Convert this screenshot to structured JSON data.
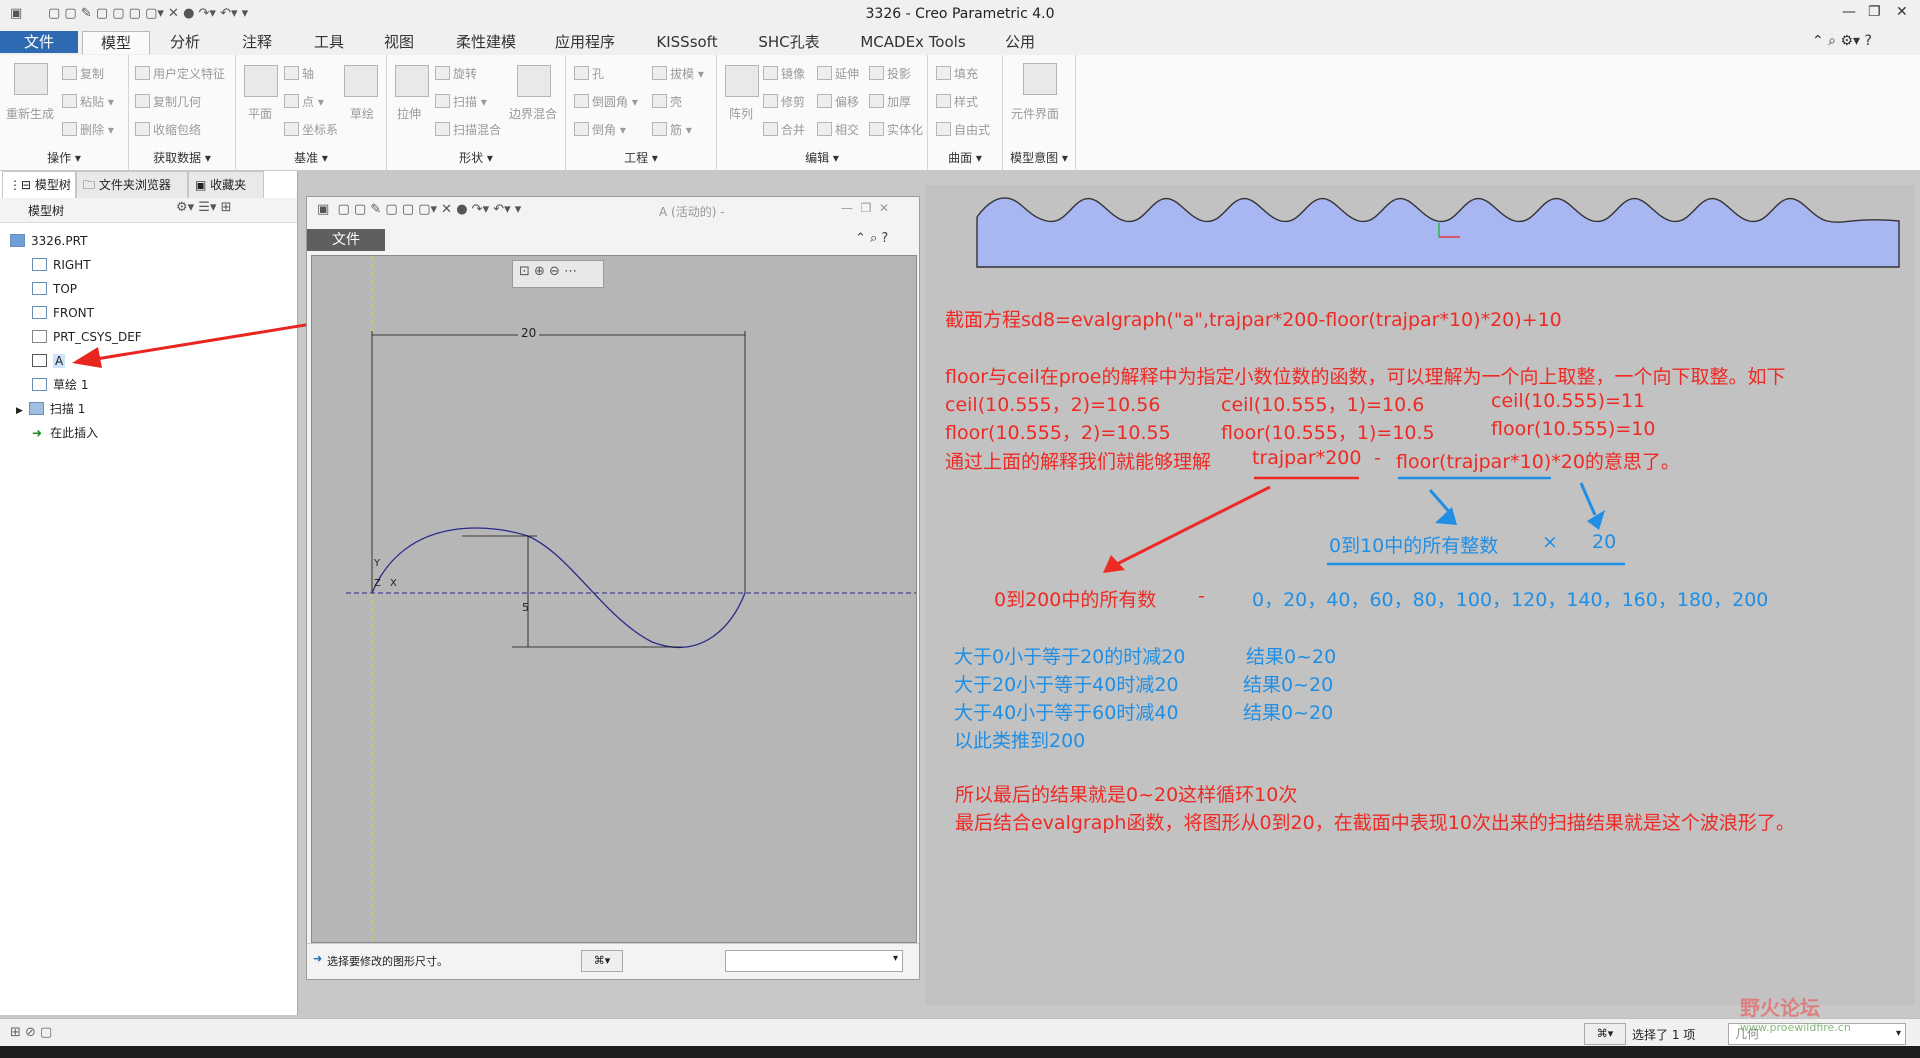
{
  "window": {
    "title": "3326 - Creo Parametric 4.0"
  },
  "tabs": [
    {
      "label": "文件"
    },
    {
      "label": "模型"
    },
    {
      "label": "分析"
    },
    {
      "label": "注释"
    },
    {
      "label": "工具"
    },
    {
      "label": "视图"
    },
    {
      "label": "柔性建模"
    },
    {
      "label": "应用程序"
    },
    {
      "label": "KISSsoft"
    },
    {
      "label": "SHC孔表"
    },
    {
      "label": "MCADEx Tools"
    },
    {
      "label": "公用"
    }
  ],
  "ribbon": {
    "groups": [
      {
        "label": "操作 ▾",
        "items": [
          "重新生成",
          "复制",
          "粘贴 ▾",
          "删除 ▾"
        ]
      },
      {
        "label": "获取数据 ▾",
        "items": [
          "用户定义特征",
          "复制几何",
          "收缩包络"
        ]
      },
      {
        "label": "基准 ▾",
        "items": [
          "平面",
          "轴",
          "点 ▾",
          "坐标系",
          "草绘"
        ]
      },
      {
        "label": "形状 ▾",
        "items": [
          "拉伸",
          "旋转",
          "扫描 ▾",
          "扫描混合",
          "边界混合"
        ]
      },
      {
        "label": "工程 ▾",
        "items": [
          "孔",
          "倒圆角 ▾",
          "倒角 ▾",
          "拔模 ▾",
          "壳",
          "筋 ▾"
        ]
      },
      {
        "label": "编辑 ▾",
        "items": [
          "阵列",
          "镜像",
          "修剪",
          "合并",
          "延伸",
          "偏移",
          "相交",
          "投影",
          "加厚",
          "实体化"
        ]
      },
      {
        "label": "曲面 ▾",
        "items": [
          "填充",
          "样式",
          "自由式"
        ]
      },
      {
        "label": "模型意图 ▾",
        "items": [
          "元件界面"
        ]
      }
    ]
  },
  "left_panel": {
    "tabs": [
      "模型树",
      "文件夹浏览器",
      "收藏夹"
    ],
    "header": "模型树",
    "tree": [
      "3326.PRT",
      "RIGHT",
      "TOP",
      "FRONT",
      "PRT_CSYS_DEF",
      "A",
      "草绘 1",
      "扫描 1",
      "在此插入"
    ]
  },
  "annotation_graphic": "图形",
  "inner_window": {
    "title": "A (活动的) -",
    "file_tab": "文件",
    "dims": {
      "width": "20",
      "height": "5"
    },
    "axes": {
      "y": "Y",
      "x": "X",
      "z": "Z"
    },
    "status": "选择要修改的图形尺寸。"
  },
  "notes": {
    "line1": "截面方程sd8=evalgraph(\"a\",trajpar*200-floor(trajpar*10)*20)+10",
    "line2": "floor与ceil在proe的解释中为指定小数位数的函数，可以理解为一个向上取整，一个向下取整。如下",
    "ceil1": "ceil(10.555，2)=10.56",
    "ceil2": "ceil(10.555，1)=10.6",
    "ceil3": "ceil(10.555)=11",
    "floor1": "floor(10.555，2)=10.55",
    "floor2": "floor(10.555，1)=10.5",
    "floor3": "floor(10.555)=10",
    "explain": "通过上面的解释我们就能够理解",
    "term1": "trajpar*200",
    "minus": "-",
    "term2": "floor(trajpar*10)*20的意思了。",
    "ints": "0到10中的所有整数",
    "times": "×",
    "twenty": "20",
    "all": "0到200中的所有数",
    "dash": "-",
    "series": "0，20，40，60，80，100，120，140，160，180，200",
    "r1a": "大于0小于等于20的时减20",
    "r1b": "结果0~20",
    "r2a": "大于20小于等于40时减20",
    "r2b": "结果0~20",
    "r3a": "大于40小于等于60时减40",
    "r3b": "结果0~20",
    "r4": "以此类推到200",
    "c1": "所以最后的结果就是0~20这样循环10次",
    "c2": "最后结合evalgraph函数，将图形从0到20，在截面中表现10次出来的扫描结果就是这个波浪形了。"
  },
  "statusbar": {
    "selected": "选择了 1 项",
    "filter": "几何",
    "watermark": "野火论坛",
    "watermark_url": "www.proewildfire.cn"
  }
}
